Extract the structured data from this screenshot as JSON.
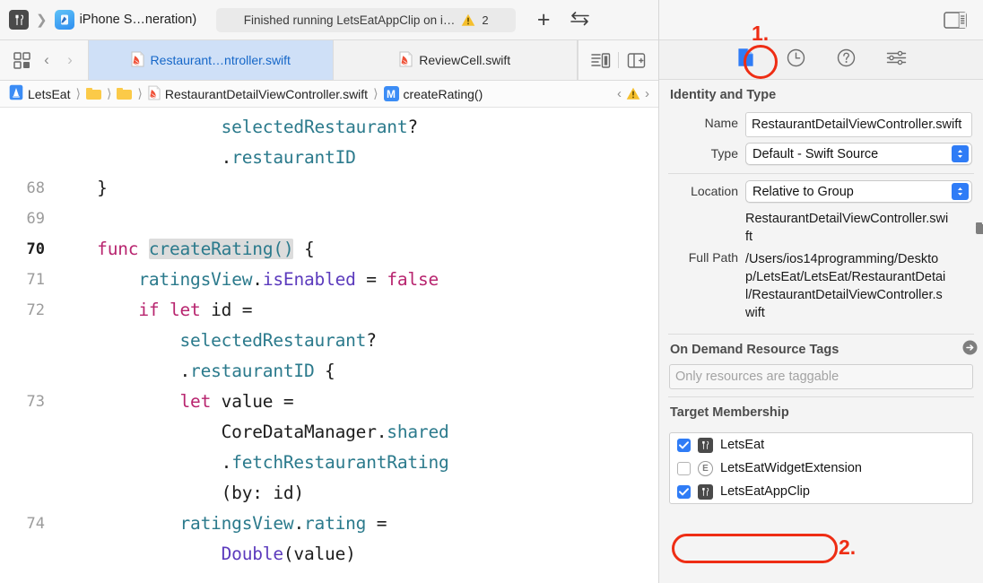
{
  "toolbar": {
    "app_icon_name": "letseat-app-icon",
    "scheme_separator": "❯",
    "destination_label": "iPhone S…neration)",
    "status_message": "Finished running LetsEatAppClip on i…",
    "warning_count": "2",
    "add_button_label": "+",
    "swap_button_label": "⇄",
    "inspector_toggle_name": "toggle-inspector-button"
  },
  "tabbar": {
    "grid_icon": "tab-overview-icon",
    "back_arrow": "‹",
    "forward_arrow": "›",
    "tabs": [
      {
        "label": "Restaurant…ntroller.swift",
        "active": true
      },
      {
        "label": "ReviewCell.swift",
        "active": false
      }
    ],
    "minimap_button": "minimap-toggle-button",
    "add_editor_button": "add-editor-button"
  },
  "breadcrumb": {
    "project": "LetsEat",
    "folder1": "",
    "folder2": "",
    "file": "RestaurantDetailViewController.swift",
    "symbol_badge": "M",
    "symbol": "createRating()",
    "paren": "()",
    "prev_issue": "‹",
    "next_issue": "›"
  },
  "code": {
    "lines": [
      {
        "num": "",
        "current": false,
        "tokens": [
          {
            "t": "                ",
            "c": "plain"
          },
          {
            "t": "selectedRestaurant",
            "c": "id"
          },
          {
            "t": "?",
            "c": "plain"
          }
        ]
      },
      {
        "num": "",
        "current": false,
        "tokens": [
          {
            "t": "                ",
            "c": "plain"
          },
          {
            "t": ".",
            "c": "plain"
          },
          {
            "t": "restaurantID",
            "c": "id"
          }
        ]
      },
      {
        "num": "68",
        "current": false,
        "tokens": [
          {
            "t": "    }",
            "c": "plain"
          }
        ]
      },
      {
        "num": "69",
        "current": false,
        "tokens": [
          {
            "t": "",
            "c": "plain"
          }
        ]
      },
      {
        "num": "70",
        "current": true,
        "tokens": [
          {
            "t": "    ",
            "c": "plain"
          },
          {
            "t": "func",
            "c": "kw"
          },
          {
            "t": " ",
            "c": "plain"
          },
          {
            "t": "createRating()",
            "c": "id sel"
          },
          {
            "t": " {",
            "c": "plain"
          }
        ]
      },
      {
        "num": "71",
        "current": false,
        "tokens": [
          {
            "t": "        ",
            "c": "plain"
          },
          {
            "t": "ratingsView",
            "c": "id"
          },
          {
            "t": ".",
            "c": "plain"
          },
          {
            "t": "isEnabled",
            "c": "typ"
          },
          {
            "t": " = ",
            "c": "plain"
          },
          {
            "t": "false",
            "c": "kw"
          }
        ]
      },
      {
        "num": "72",
        "current": false,
        "tokens": [
          {
            "t": "        ",
            "c": "plain"
          },
          {
            "t": "if let",
            "c": "kw"
          },
          {
            "t": " id =",
            "c": "plain"
          }
        ]
      },
      {
        "num": "",
        "current": false,
        "tokens": [
          {
            "t": "            ",
            "c": "plain"
          },
          {
            "t": "selectedRestaurant",
            "c": "id"
          },
          {
            "t": "?",
            "c": "plain"
          }
        ]
      },
      {
        "num": "",
        "current": false,
        "tokens": [
          {
            "t": "            ",
            "c": "plain"
          },
          {
            "t": ".",
            "c": "plain"
          },
          {
            "t": "restaurantID",
            "c": "id"
          },
          {
            "t": " {",
            "c": "plain"
          }
        ]
      },
      {
        "num": "73",
        "current": false,
        "tokens": [
          {
            "t": "            ",
            "c": "plain"
          },
          {
            "t": "let",
            "c": "kw"
          },
          {
            "t": " value =",
            "c": "plain"
          }
        ]
      },
      {
        "num": "",
        "current": false,
        "tokens": [
          {
            "t": "                ",
            "c": "plain"
          },
          {
            "t": "CoreDataManager",
            "c": "plain"
          },
          {
            "t": ".",
            "c": "plain"
          },
          {
            "t": "shared",
            "c": "id"
          }
        ]
      },
      {
        "num": "",
        "current": false,
        "tokens": [
          {
            "t": "                ",
            "c": "plain"
          },
          {
            "t": ".",
            "c": "plain"
          },
          {
            "t": "fetchRestaurantRating",
            "c": "id"
          }
        ]
      },
      {
        "num": "",
        "current": false,
        "tokens": [
          {
            "t": "                (by: id)",
            "c": "plain"
          }
        ]
      },
      {
        "num": "74",
        "current": false,
        "tokens": [
          {
            "t": "            ",
            "c": "plain"
          },
          {
            "t": "ratingsView",
            "c": "id"
          },
          {
            "t": ".",
            "c": "plain"
          },
          {
            "t": "rating",
            "c": "id"
          },
          {
            "t": " =",
            "c": "plain"
          }
        ]
      },
      {
        "num": "",
        "current": false,
        "tokens": [
          {
            "t": "                ",
            "c": "plain"
          },
          {
            "t": "Double",
            "c": "typ"
          },
          {
            "t": "(value)",
            "c": "plain"
          }
        ]
      }
    ]
  },
  "inspector": {
    "tabs": [
      {
        "name": "file-inspector-tab",
        "icon": "document-icon",
        "selected": true
      },
      {
        "name": "history-inspector-tab",
        "icon": "clock-icon",
        "selected": false
      },
      {
        "name": "help-inspector-tab",
        "icon": "question-icon",
        "selected": false
      },
      {
        "name": "quick-help-tab",
        "icon": "sliders-icon",
        "selected": false
      }
    ],
    "identity_and_type": {
      "title": "Identity and Type",
      "name_label": "Name",
      "name_value": "RestaurantDetailViewController.swift",
      "type_label": "Type",
      "type_value": "Default - Swift Source",
      "location_label": "Location",
      "location_value": "Relative to Group",
      "location_file": "RestaurantDetailViewController.swift",
      "full_path_label": "Full Path",
      "full_path_value": "/Users/ios14programming/Desktop/LetsEat/LetsEat/RestaurantDetail/RestaurantDetailViewController.swift"
    },
    "on_demand": {
      "title": "On Demand Resource Tags",
      "placeholder": "Only resources are taggable"
    },
    "target_membership": {
      "title": "Target Membership",
      "rows": [
        {
          "label": "LetsEat",
          "checked": true,
          "icon": "app-target-icon"
        },
        {
          "label": "LetsEatWidgetExtension",
          "checked": false,
          "icon": "extension-target-icon"
        },
        {
          "label": "LetsEatAppClip",
          "checked": true,
          "icon": "app-target-icon"
        }
      ]
    }
  },
  "annotations": {
    "callout_1": "1.",
    "callout_2": "2.",
    "accent_color": "#ee2d14"
  }
}
